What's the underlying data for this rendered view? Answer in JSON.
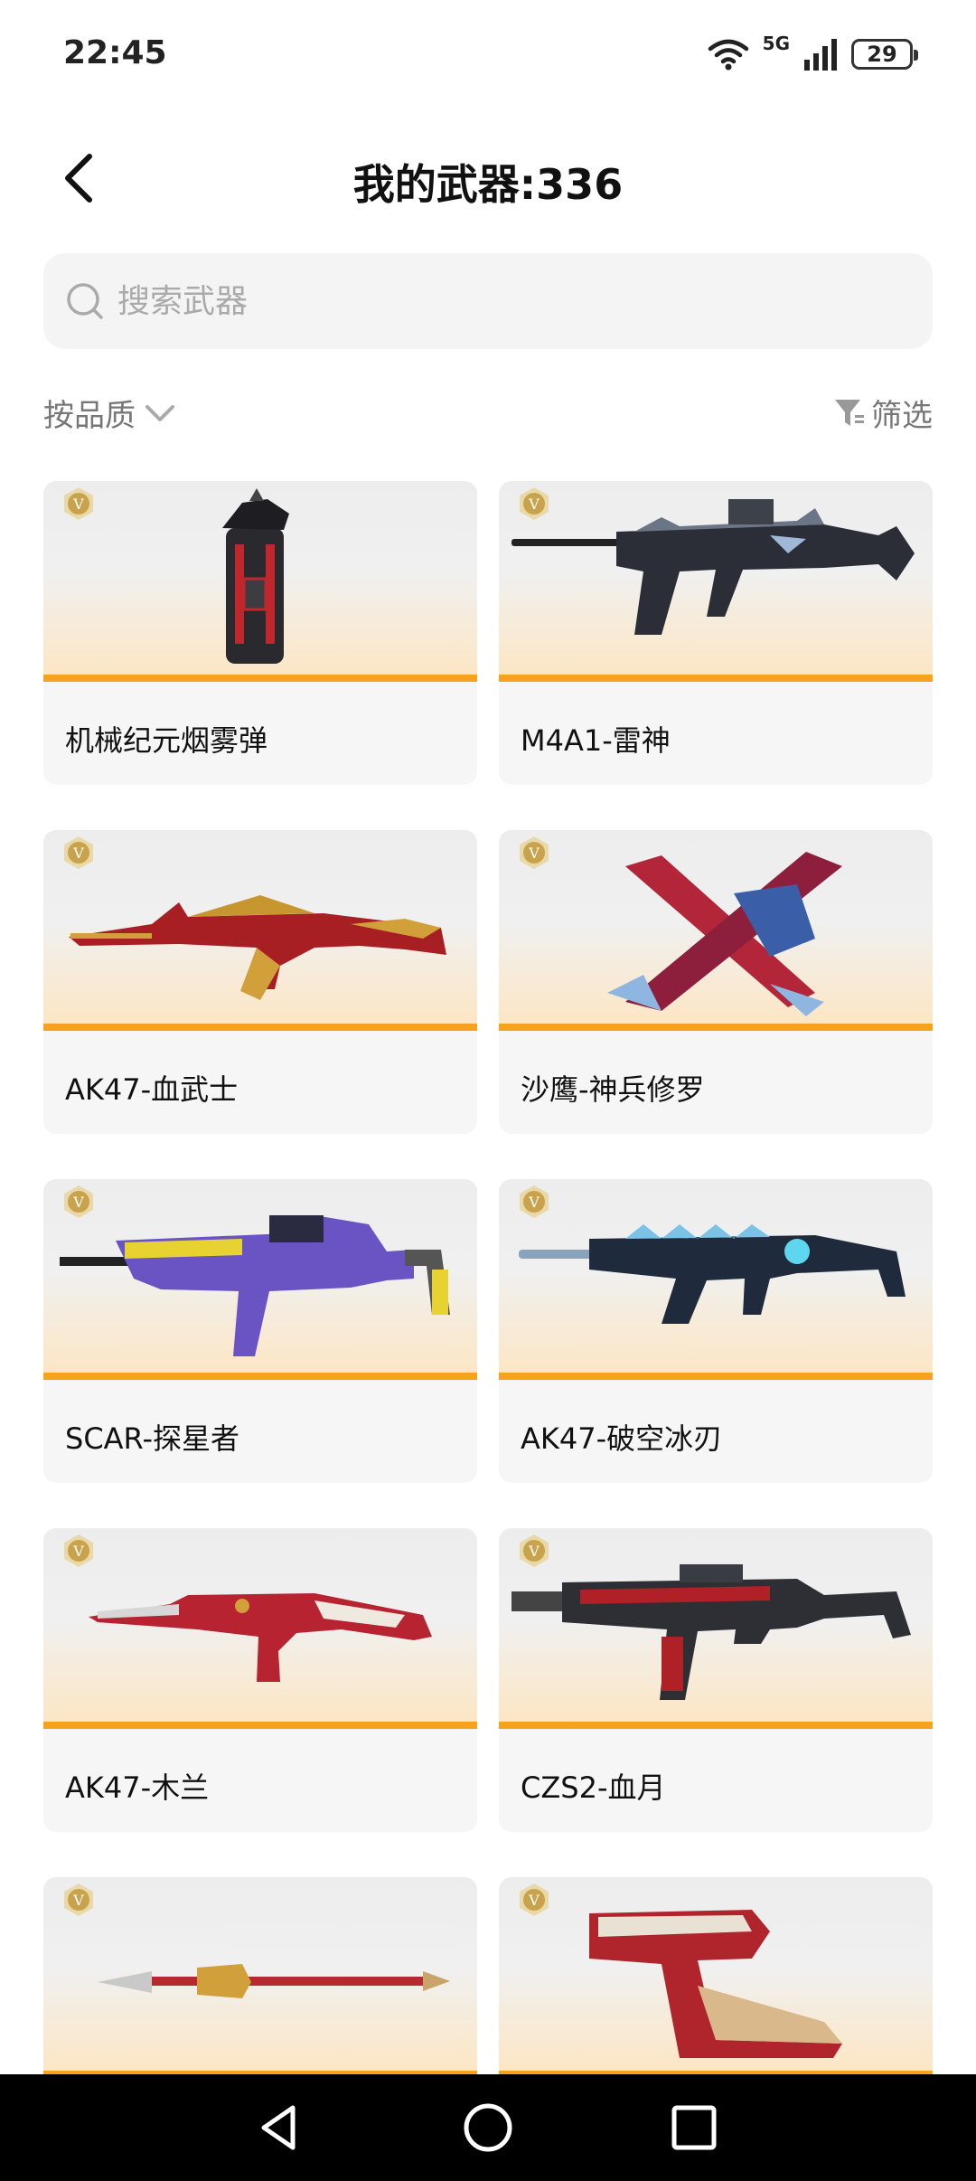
{
  "status_bar": {
    "time": "22:45",
    "network": "5G",
    "battery": "29"
  },
  "header": {
    "title": "我的武器:336"
  },
  "search": {
    "placeholder": "搜索武器",
    "value": ""
  },
  "sort": {
    "label": "按品质"
  },
  "filter": {
    "label": "筛选"
  },
  "colors": {
    "accent": "#f6a21c",
    "badge": "#c9a34c"
  },
  "weapons": [
    {
      "name": "机械纪元烟雾弹",
      "badge": "V",
      "art": "smoke-grenade"
    },
    {
      "name": "M4A1-雷神",
      "badge": "V",
      "art": "rifle-dark"
    },
    {
      "name": "AK47-血武士",
      "badge": "V",
      "art": "rifle-red-gold"
    },
    {
      "name": "沙鹰-神兵修罗",
      "badge": "V",
      "art": "crossed-blades"
    },
    {
      "name": "SCAR-探星者",
      "badge": "V",
      "art": "rifle-purple"
    },
    {
      "name": "AK47-破空冰刃",
      "badge": "V",
      "art": "rifle-ice"
    },
    {
      "name": "AK47-木兰",
      "badge": "V",
      "art": "rifle-white-red"
    },
    {
      "name": "CZS2-血月",
      "badge": "V",
      "art": "smg-dark-red"
    },
    {
      "name": "",
      "badge": "V",
      "art": "spear"
    },
    {
      "name": "",
      "badge": "V",
      "art": "pistol-red"
    }
  ],
  "nav": {
    "back": "back-icon",
    "home": "home-icon",
    "recents": "recents-icon"
  }
}
